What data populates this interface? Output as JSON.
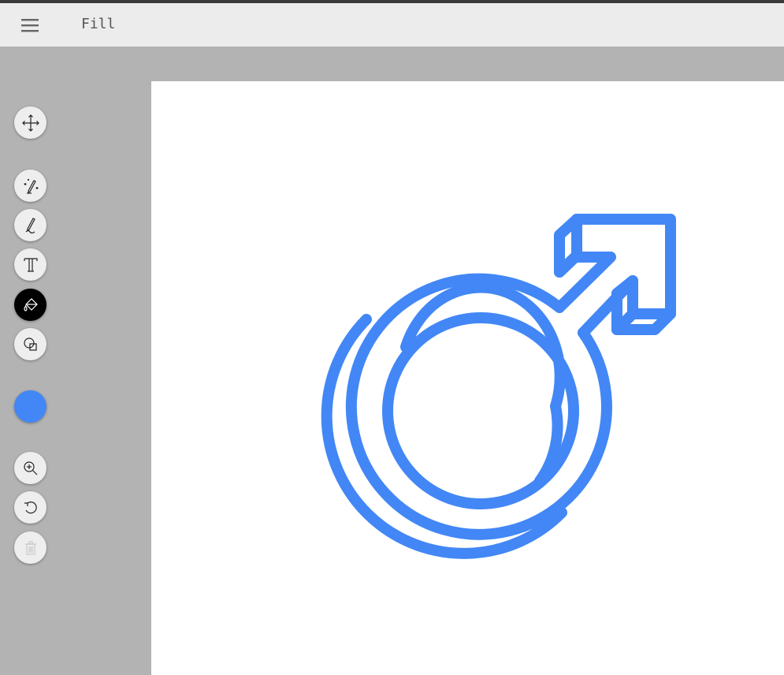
{
  "header": {
    "title": "Fill",
    "menu_icon": "hamburger-menu-icon"
  },
  "toolbar": {
    "tools": [
      {
        "name": "move-tool",
        "icon": "move-arrows-icon"
      },
      {
        "name": "magic-draw-tool",
        "icon": "magic-pencil-icon"
      },
      {
        "name": "pen-tool",
        "icon": "pen-icon"
      },
      {
        "name": "text-tool",
        "icon": "text-icon"
      },
      {
        "name": "fill-tool",
        "icon": "paint-bucket-icon",
        "active": true
      },
      {
        "name": "shape-tool",
        "icon": "shapes-icon"
      },
      {
        "name": "zoom-tool",
        "icon": "zoom-in-icon"
      },
      {
        "name": "undo-tool",
        "icon": "undo-icon"
      },
      {
        "name": "delete-tool",
        "icon": "trash-icon",
        "disabled": true
      }
    ],
    "current_color": "#4287f5"
  },
  "canvas": {
    "background": "#ffffff",
    "drawing": "male-symbol-outline",
    "stroke_color": "#4287f5"
  }
}
